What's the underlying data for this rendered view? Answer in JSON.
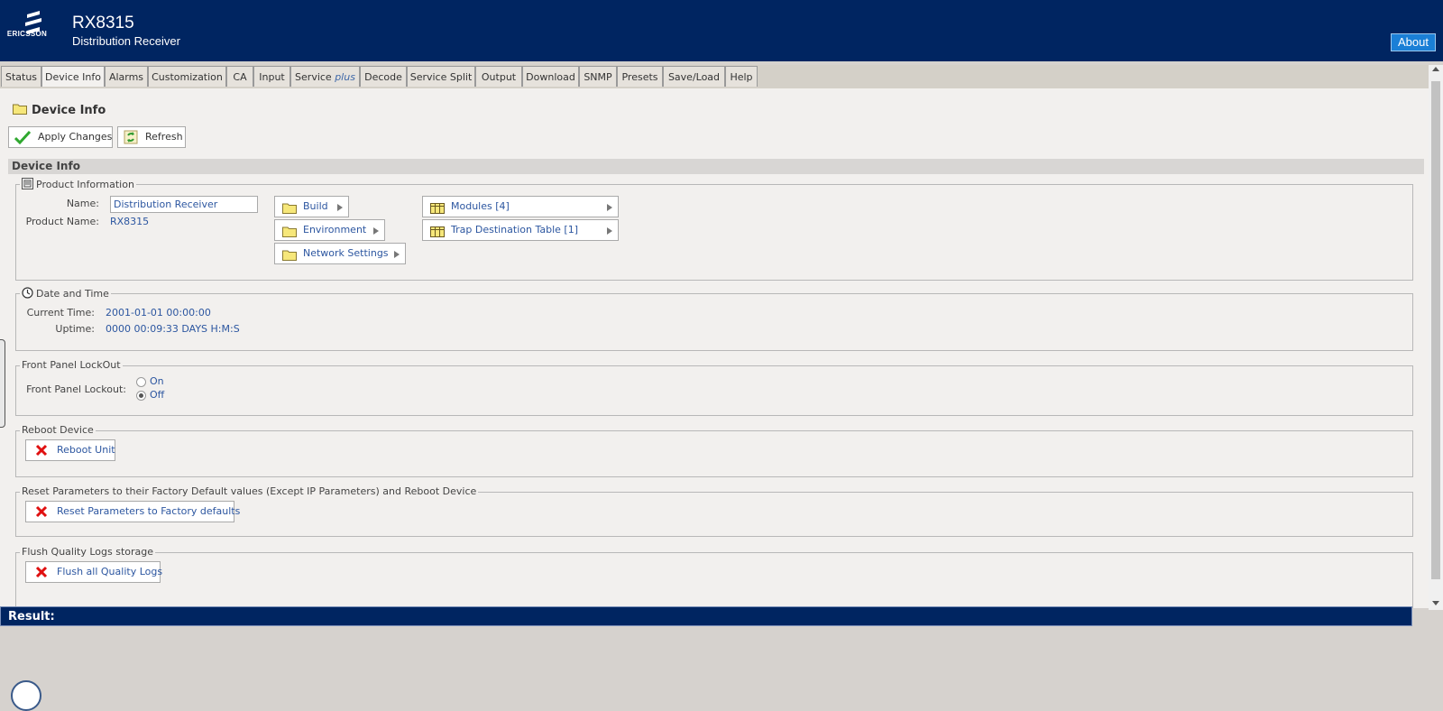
{
  "header": {
    "brand": "ERICSSON",
    "product": "RX8315",
    "product_desc": "Distribution Receiver",
    "about_label": "About"
  },
  "tabs": [
    {
      "label": "Status"
    },
    {
      "label": "Device Info",
      "active": true
    },
    {
      "label": "Alarms"
    },
    {
      "label": "Customization"
    },
    {
      "label": "CA"
    },
    {
      "label": "Input"
    },
    {
      "label": "Service",
      "suffix": "plus"
    },
    {
      "label": "Decode"
    },
    {
      "label": "Service Split"
    },
    {
      "label": "Output"
    },
    {
      "label": "Download"
    },
    {
      "label": "SNMP"
    },
    {
      "label": "Presets"
    },
    {
      "label": "Save/Load"
    },
    {
      "label": "Help"
    }
  ],
  "page": {
    "title": "Device Info",
    "apply_label": "Apply Changes",
    "refresh_label": "Refresh",
    "section_title": "Device Info"
  },
  "product_info": {
    "legend": "Product Information",
    "name_label": "Name:",
    "name_value": "Distribution Receiver",
    "product_name_label": "Product Name:",
    "product_name_value": "RX8315",
    "nav": {
      "build": "Build",
      "environment": "Environment",
      "network": "Network Settings",
      "modules": "Modules [4]",
      "trap": "Trap Destination Table [1]"
    }
  },
  "date_time": {
    "legend": "Date and Time",
    "current_label": "Current Time:",
    "current_value": "2001-01-01 00:00:00",
    "uptime_label": "Uptime:",
    "uptime_value": "0000 00:09:33 DAYS H:M:S"
  },
  "lockout": {
    "legend": "Front Panel LockOut",
    "label": "Front Panel Lockout:",
    "on_label": "On",
    "off_label": "Off",
    "selected": "Off"
  },
  "reboot": {
    "legend": "Reboot Device",
    "button": "Reboot Unit"
  },
  "reset": {
    "legend": "Reset Parameters to their Factory Default values (Except IP Parameters) and Reboot Device",
    "button": "Reset Parameters to Factory defaults"
  },
  "flush": {
    "legend": "Flush Quality Logs storage",
    "button": "Flush all Quality Logs"
  },
  "result": {
    "label": "Result:"
  },
  "colors": {
    "header_bg": "#002561",
    "link": "#2c56a0",
    "about_bg": "#1a7fd6"
  }
}
